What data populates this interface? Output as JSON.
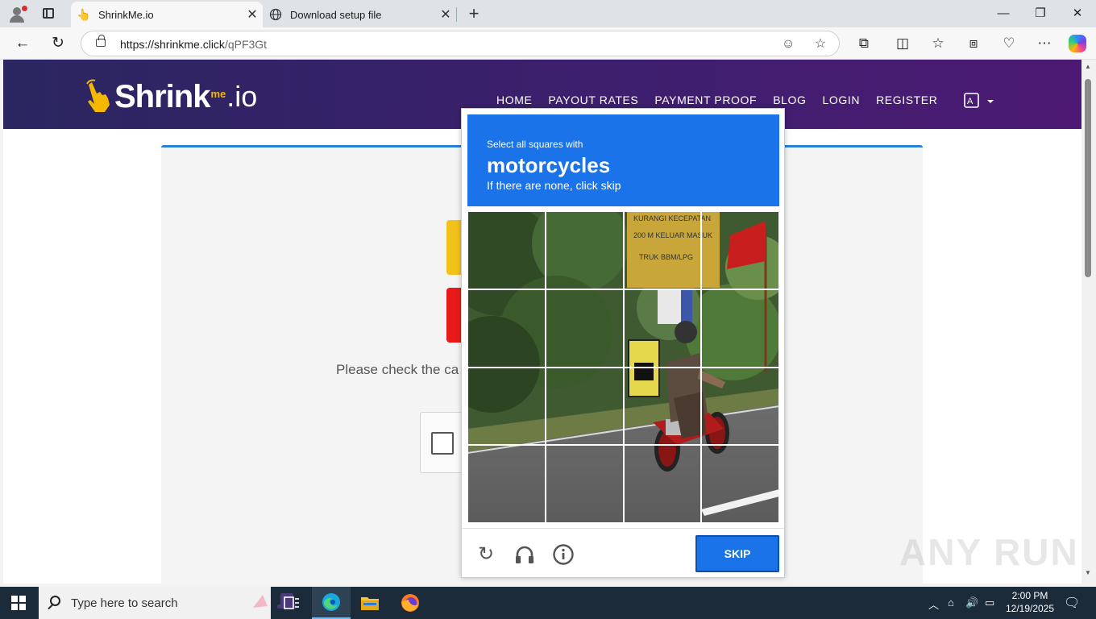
{
  "browser": {
    "tabs": [
      {
        "title": "ShrinkMe.io",
        "active": true
      },
      {
        "title": "Download setup file",
        "active": false
      }
    ],
    "url_domain": "https://shrinkme.click",
    "url_path": "/qPF3Gt"
  },
  "site": {
    "logo_main": "Shrink",
    "logo_me": "me",
    "logo_io": ".io",
    "nav": [
      "HOME",
      "PAYOUT RATES",
      "PAYMENT PROOF",
      "BLOG",
      "LOGIN",
      "REGISTER"
    ],
    "please_text": "Please check the ca"
  },
  "captcha": {
    "line1": "Select all squares with",
    "target": "motorcycles",
    "line3": "If there are none, click skip",
    "skip_label": "SKIP",
    "sign_text_1": "KURANGI KECEPATAN",
    "sign_text_2": "200 M KELUAR MASUK",
    "sign_text_3": "TRUK BBM/LPG"
  },
  "taskbar": {
    "search_placeholder": "Type here to search",
    "time": "2:00 PM",
    "date": "12/19/2025"
  },
  "watermark": "ANY RUN",
  "colors": {
    "captcha_blue": "#1a73e8",
    "header_purple": "#3d1f6e",
    "card_accent": "#2a7fd6"
  }
}
